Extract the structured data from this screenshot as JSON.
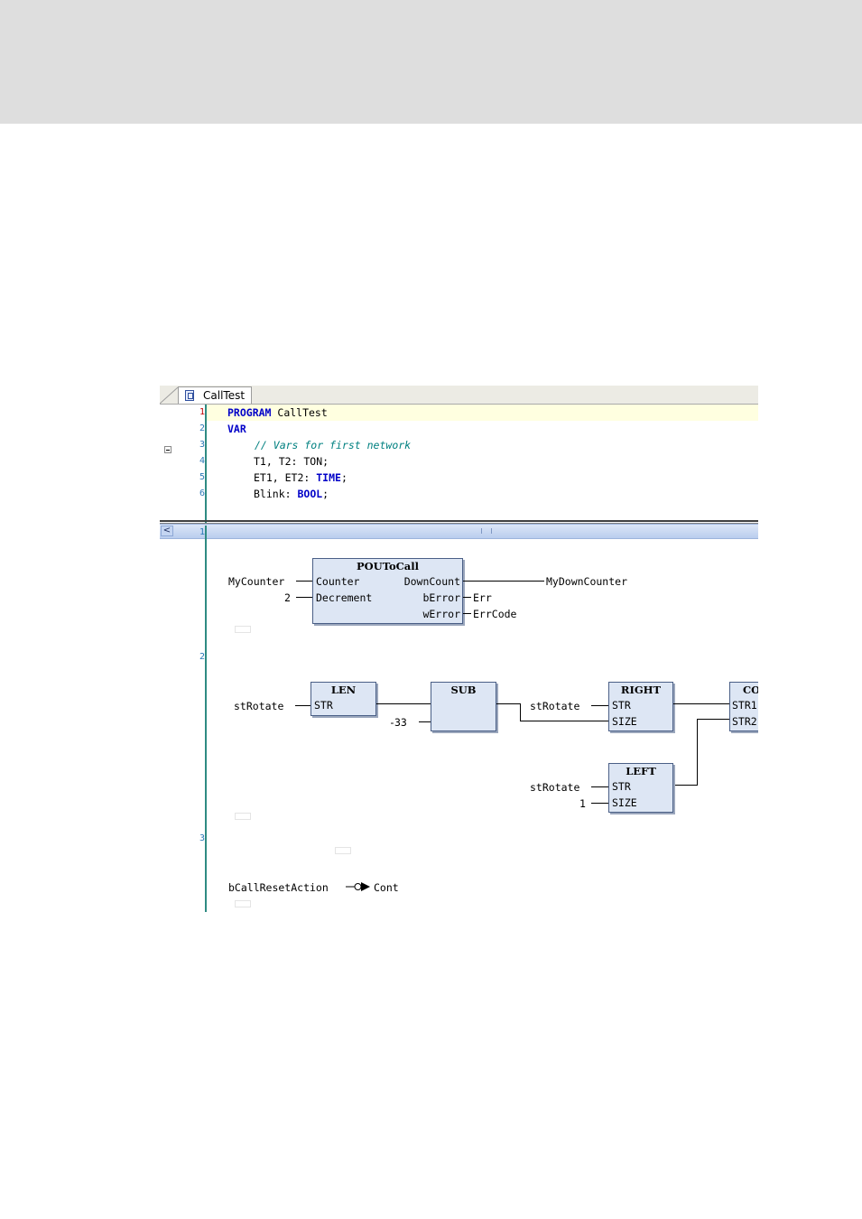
{
  "editor": {
    "tab_label": "CallTest",
    "decl": {
      "lines": [
        {
          "n": "1",
          "kw": "PROGRAM",
          "rest": " CallTest"
        },
        {
          "n": "2",
          "kw": "VAR",
          "rest": ""
        },
        {
          "n": "3",
          "comment": "// Vars for first network"
        },
        {
          "n": "4",
          "text": "T1, T2: TON;"
        },
        {
          "n": "5",
          "text": "ET1, ET2: ",
          "type": "TIME",
          "tail": ";"
        },
        {
          "n": "6",
          "text": "Blink: ",
          "type": "BOOL",
          "tail": ";"
        }
      ]
    },
    "scroll_left_glyph": "<",
    "networks": {
      "n1": {
        "number": "1",
        "block": {
          "title": "POUToCall",
          "inputs": [
            "Counter",
            "Decrement"
          ],
          "outputs": [
            "DownCount",
            "bError",
            "wError"
          ]
        },
        "in_vars": [
          "MyCounter",
          "2"
        ],
        "out_vars": [
          "MyDownCounter",
          "Err",
          "ErrCode"
        ]
      },
      "n2": {
        "number": "2",
        "len": {
          "title": "LEN",
          "input": "STR"
        },
        "sub": {
          "title": "SUB"
        },
        "right": {
          "title": "RIGHT",
          "inputs": [
            "STR",
            "SIZE"
          ]
        },
        "concat": {
          "title": "CON",
          "inputs": [
            "STR1",
            "STR2"
          ]
        },
        "left": {
          "title": "LEFT",
          "inputs": [
            "STR",
            "SIZE"
          ]
        },
        "in_var_len": "stRotate",
        "const_sub": "33",
        "in_var_right": "stRotate",
        "in_var_left": "stRotate",
        "const_left": "1"
      },
      "n3": {
        "number": "3",
        "in_var": "bCallResetAction",
        "target": "Cont"
      }
    }
  }
}
